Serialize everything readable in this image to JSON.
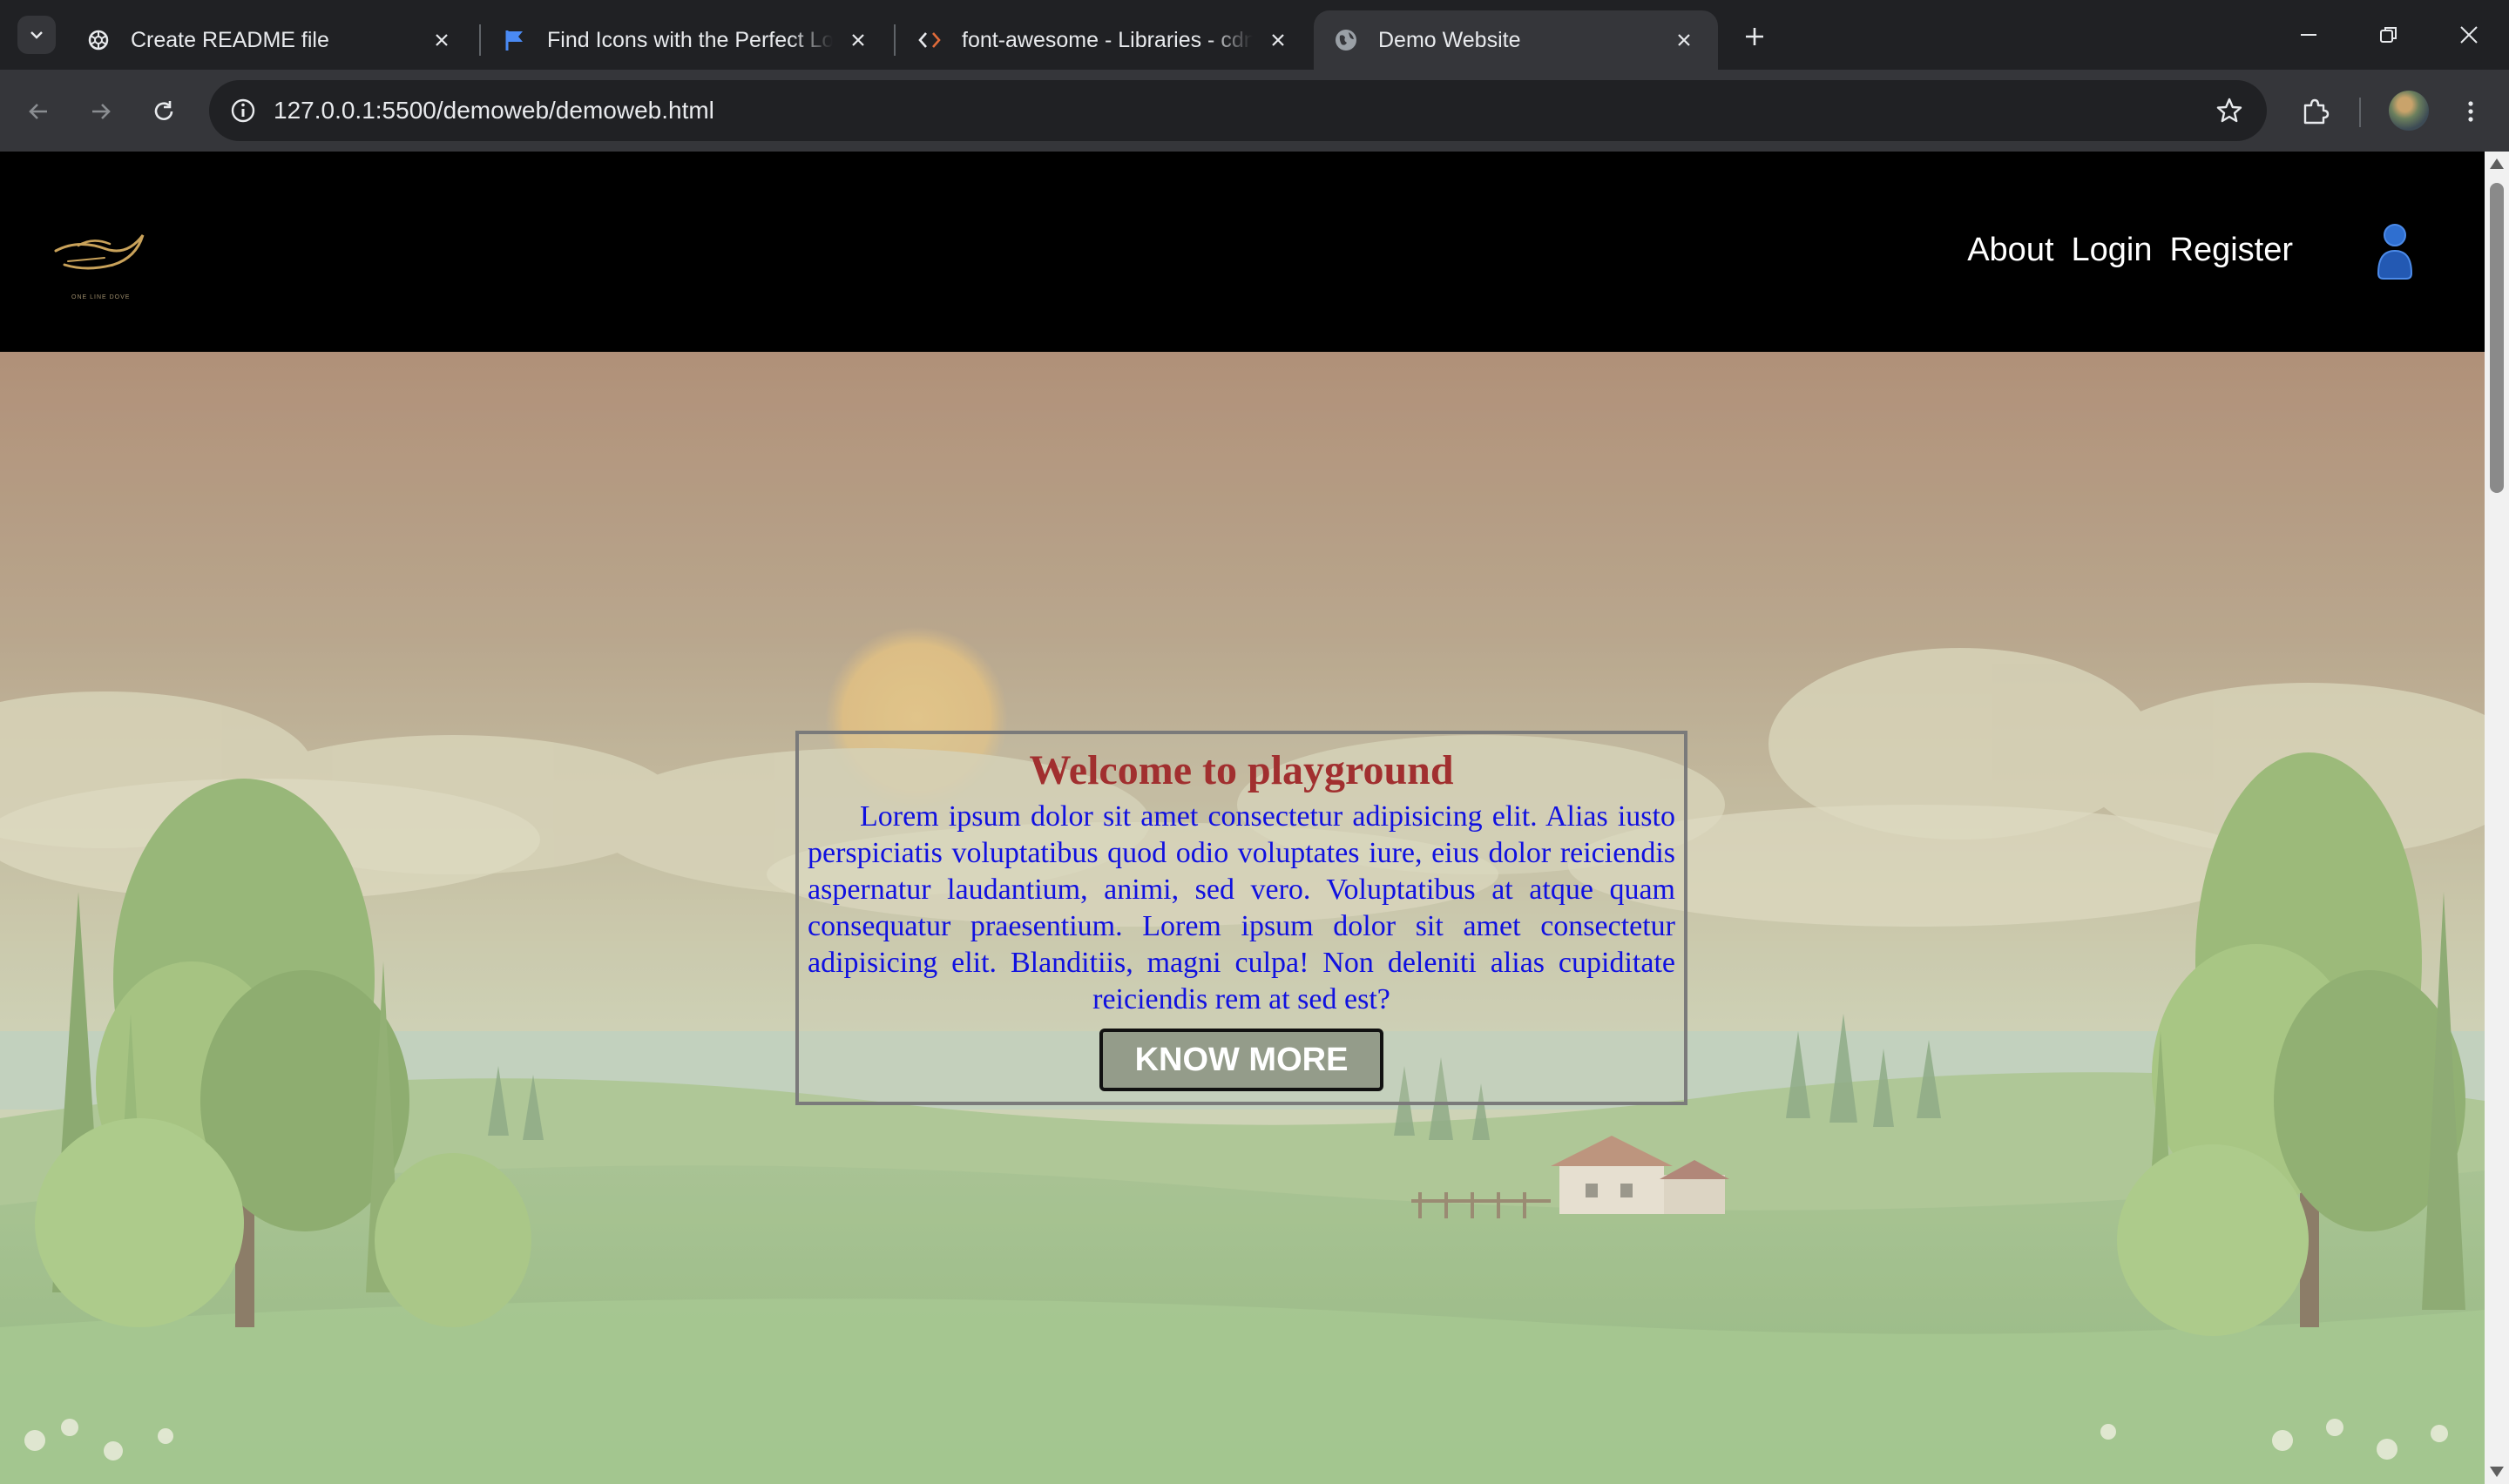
{
  "browser": {
    "tabs": [
      {
        "title": "Create README file",
        "favicon": "openai-icon",
        "active": false
      },
      {
        "title": "Find Icons with the Perfect Look",
        "favicon": "flag-icon",
        "active": false
      },
      {
        "title": "font-awesome - Libraries - cdnjs",
        "favicon": "code-brackets-icon",
        "active": false
      },
      {
        "title": "Demo Website",
        "favicon": "globe-icon",
        "active": true
      }
    ],
    "url": "127.0.0.1:5500/demoweb/demoweb.html"
  },
  "site": {
    "logo_tagline": "ONE LINE DOVE",
    "nav": [
      {
        "label": "About"
      },
      {
        "label": "Login"
      },
      {
        "label": "Register"
      }
    ],
    "hero": {
      "title": "Welcome to playground",
      "text": "Lorem ipsum dolor sit amet consectetur adipisicing elit. Alias iusto perspiciatis voluptatibus quod odio voluptates iure, eius dolor reiciendis aspernatur laudantium, animi, sed vero. Voluptatibus at atque quam consequatur praesentium. Lorem ipsum dolor sit amet consectetur adipisicing elit. Blanditiis, magni culpa! Non deleniti alias cupiditate reiciendis rem at sed est?",
      "button": "KNOW MORE"
    }
  },
  "colors": {
    "chrome_dark": "#202124",
    "chrome_toolbar": "#35363a",
    "hero_title": "#a12f2f",
    "hero_text": "#1010e0",
    "user_icon": "#2f6fd0"
  }
}
